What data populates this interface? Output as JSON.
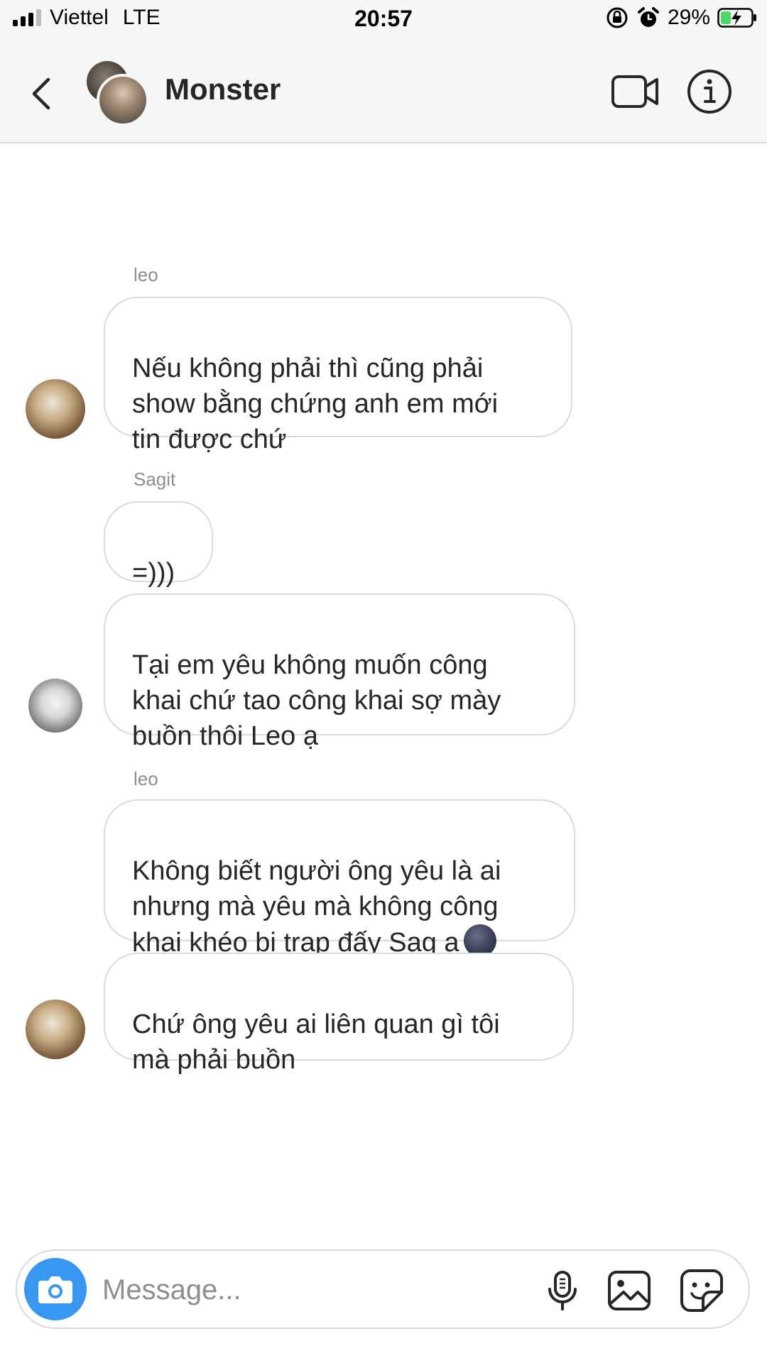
{
  "status_bar": {
    "carrier": "Viettel",
    "network": "LTE",
    "time": "20:57",
    "battery": "29%"
  },
  "header": {
    "title": "Monster"
  },
  "messages": [
    {
      "sender": "leo",
      "text": "Nếu không phải thì cũng phải\nshow bằng chứng anh em mới\ntin được chứ"
    },
    {
      "sender": "Sagit",
      "text": "=)))"
    },
    {
      "sender": "",
      "text": "Tại em yêu không muốn công\nkhai chứ tao công khai sợ mày\nbuồn thôi Leo ạ"
    },
    {
      "sender": "leo",
      "text": "Không biết người ông yêu là ai\nnhưng mà yêu mà không công\nkhai khéo bị trap đấy Sag ạ",
      "emoji": "new-moon-face"
    },
    {
      "sender": "",
      "text": "Chứ ông yêu ai liên quan gì tôi\nmà phải buồn"
    }
  ],
  "composer": {
    "placeholder": "Message..."
  },
  "colors": {
    "accent_blue": "#3897f0",
    "bubble_border": "#dbdbdb",
    "header_bg": "#f7f7f7",
    "secondary_text": "#8e8e8e"
  }
}
